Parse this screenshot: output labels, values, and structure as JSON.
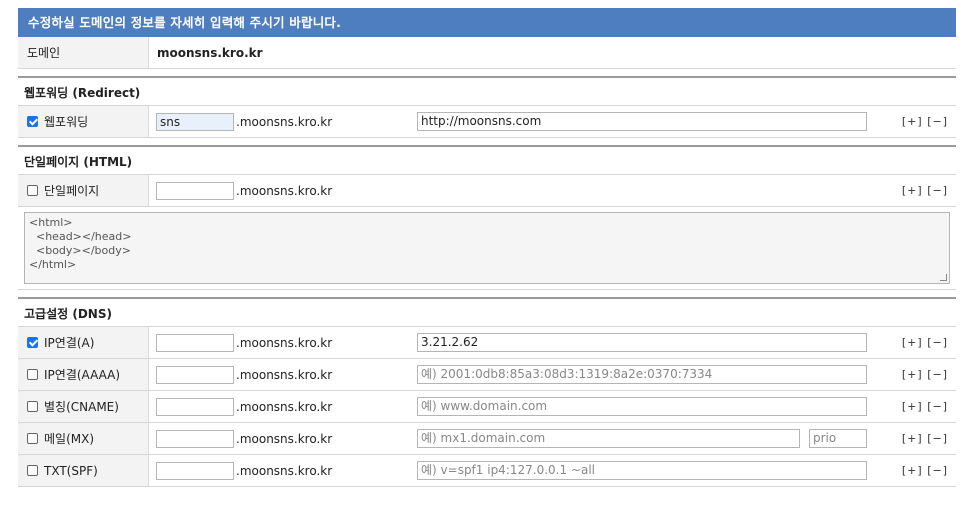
{
  "banner": "수정하실 도메인의 정보를 자세히 입력해 주시기 바랍니다.",
  "domain": {
    "label": "도메인",
    "value": "moonsns.kro.kr"
  },
  "suffix": ".moonsns.kro.kr",
  "add_label": "[+]",
  "remove_label": "[−]",
  "redirect": {
    "title": "웹포워딩 (Redirect)",
    "label": "웹포워딩",
    "checked": true,
    "subdomain": "sns",
    "target": "http://moonsns.com"
  },
  "html": {
    "title": "단일페이지 (HTML)",
    "label": "단일페이지",
    "checked": false,
    "subdomain": "",
    "code": "<html>\n  <head></head>\n  <body></body>\n</html>"
  },
  "dns": {
    "title": "고급설정 (DNS)",
    "rows": [
      {
        "label": "IP연결(A)",
        "checked": true,
        "subdomain": "",
        "value": "3.21.2.62",
        "placeholder": ""
      },
      {
        "label": "IP연결(AAAA)",
        "checked": false,
        "subdomain": "",
        "value": "",
        "placeholder": "예) 2001:0db8:85a3:08d3:1319:8a2e:0370:7334"
      },
      {
        "label": "별칭(CNAME)",
        "checked": false,
        "subdomain": "",
        "value": "",
        "placeholder": "예) www.domain.com"
      },
      {
        "label": "메일(MX)",
        "checked": false,
        "subdomain": "",
        "value": "",
        "placeholder": "예) mx1.domain.com",
        "prio_placeholder": "prio"
      },
      {
        "label": "TXT(SPF)",
        "checked": false,
        "subdomain": "",
        "value": "",
        "placeholder": "예) v=spf1 ip4:127.0.0.1 ~all"
      }
    ]
  }
}
